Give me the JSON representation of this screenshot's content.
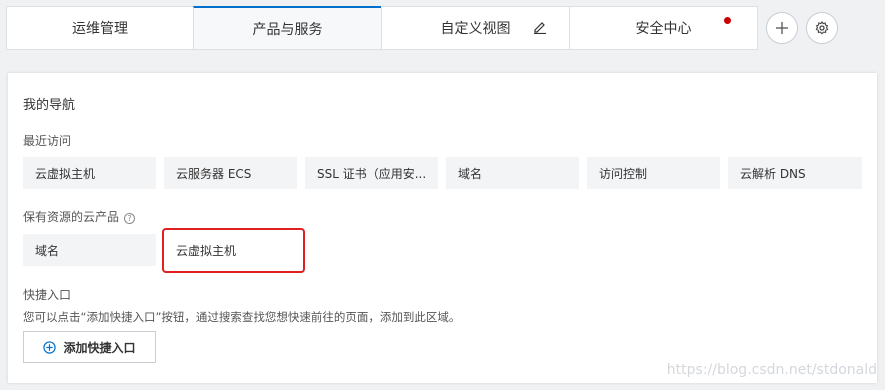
{
  "tabs": [
    {
      "label": "运维管理"
    },
    {
      "label": "产品与服务"
    },
    {
      "label": "自定义视图"
    },
    {
      "label": "安全中心"
    }
  ],
  "panel": {
    "title": "我的导航",
    "recent": {
      "title": "最近访问",
      "items": [
        "云虚拟主机",
        "云服务器 ECS",
        "SSL 证书（应用安...",
        "域名",
        "访问控制",
        "云解析 DNS"
      ]
    },
    "owned": {
      "title": "保有资源的云产品",
      "help_glyph": "?",
      "items": [
        "域名",
        "云虚拟主机"
      ]
    },
    "shortcut": {
      "title": "快捷入口",
      "description": "您可以点击“添加快捷入口”按钮，通过搜索查找您想快速前往的页面，添加到此区域。",
      "add_button": "添加快捷入口"
    }
  },
  "watermark": "https://blog.csdn.net/stdonald",
  "colors": {
    "accent": "#0070cc",
    "highlight_border": "#e02020",
    "alert_dot": "#cc0000"
  }
}
